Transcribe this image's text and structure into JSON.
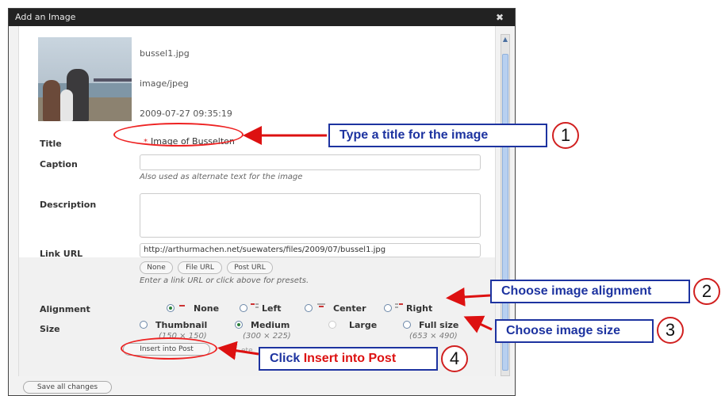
{
  "dialog": {
    "title": "Add an Image",
    "close_icon": "close-icon"
  },
  "attachment": {
    "filename": "bussel1.jpg",
    "mime_type": "image/jpeg",
    "date": "2009-07-27 09:35:19"
  },
  "form": {
    "title_label": "Title",
    "title_required_mark": "*",
    "title_value": "Image of Busselton",
    "caption_label": "Caption",
    "caption_value": "",
    "caption_hint": "Also used as alternate text for the image",
    "description_label": "Description",
    "description_value": "",
    "link_label": "Link URL",
    "link_value": "http://arthurmachen.net/suewaters/files/2009/07/bussel1.jpg",
    "link_buttons": [
      "None",
      "File URL",
      "Post URL"
    ],
    "link_hint": "Enter a link URL or click above for presets.",
    "alignment_label": "Alignment",
    "alignment_options": [
      "None",
      "Left",
      "Center",
      "Right"
    ],
    "alignment_selected": "None",
    "size_label": "Size",
    "size_options": [
      {
        "label": "Thumbnail",
        "dims": "(150 × 150)"
      },
      {
        "label": "Medium",
        "dims": "(300 × 225)"
      },
      {
        "label": "Large",
        "dims": ""
      },
      {
        "label": "Full size",
        "dims": "(653 × 490)"
      }
    ],
    "size_selected": "Medium",
    "insert_button": "Insert into Post",
    "insert_trailing_fragment": "ete",
    "save_button": "Save all changes"
  },
  "callouts": {
    "step1": {
      "number": "1",
      "text": "Type a title for the image"
    },
    "step2": {
      "number": "2",
      "text": "Choose image alignment"
    },
    "step3": {
      "number": "3",
      "text": "Choose image size"
    },
    "step4": {
      "number": "4",
      "text_prefix": "Click ",
      "text_highlight": "Insert into Post"
    }
  },
  "colors": {
    "callout_blue": "#1d33a0",
    "annotation_red": "#dd1111",
    "scroll_blue": "#b8d0f0"
  }
}
